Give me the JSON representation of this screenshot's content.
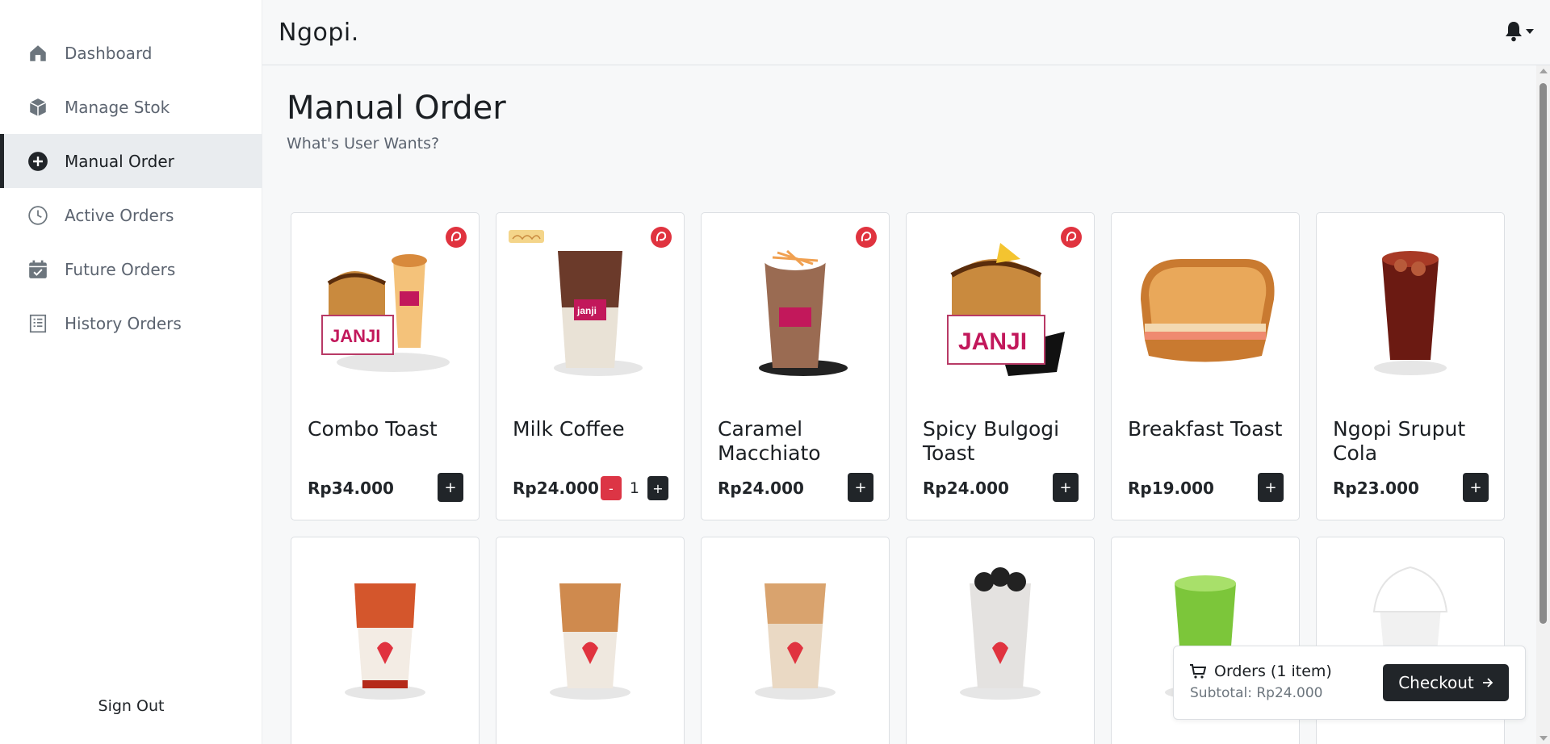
{
  "app": {
    "brand": "Ngopi."
  },
  "sidebar": {
    "items": [
      {
        "label": "Dashboard",
        "icon": "home-icon"
      },
      {
        "label": "Manage Stok",
        "icon": "box-icon"
      },
      {
        "label": "Manual Order",
        "icon": "plus-circle-icon",
        "active": true
      },
      {
        "label": "Active Orders",
        "icon": "clock-icon"
      },
      {
        "label": "Future Orders",
        "icon": "calendar-check-icon"
      },
      {
        "label": "History Orders",
        "icon": "receipt-icon"
      }
    ],
    "sign_out": "Sign Out"
  },
  "page": {
    "title": "Manual Order",
    "subtitle": "What's User Wants?"
  },
  "products": [
    {
      "name": "Combo Toast",
      "price": "Rp34.000",
      "image": "toast-and-drink"
    },
    {
      "name": "Milk Coffee",
      "price": "Rp24.000",
      "image": "iced-coffee",
      "qty": "1"
    },
    {
      "name": "Caramel Macchiato",
      "price": "Rp24.000",
      "image": "caramel-drink"
    },
    {
      "name": "Spicy Bulgogi Toast",
      "price": "Rp24.000",
      "image": "toast-box"
    },
    {
      "name": "Breakfast Toast",
      "price": "Rp19.000",
      "image": "sandwich"
    },
    {
      "name": "Ngopi Sruput Cola",
      "price": "Rp23.000",
      "image": "cola-drink"
    },
    {
      "name": "",
      "price": "",
      "image": "iced-drink"
    },
    {
      "name": "",
      "price": "",
      "image": "iced-drink"
    },
    {
      "name": "",
      "price": "",
      "image": "iced-drink"
    },
    {
      "name": "",
      "price": "",
      "image": "oreo-drink"
    },
    {
      "name": "",
      "price": "",
      "image": "green-drink"
    },
    {
      "name": "",
      "price": "",
      "image": "cream-drink"
    }
  ],
  "buttons": {
    "add": "+",
    "remove": "-"
  },
  "order": {
    "title": "Orders (1 item)",
    "subtotal": "Subtotal: Rp24.000",
    "checkout": "Checkout"
  },
  "colors": {
    "accent": "#212529",
    "danger": "#dc3545",
    "brand_red": "#e0333f"
  }
}
